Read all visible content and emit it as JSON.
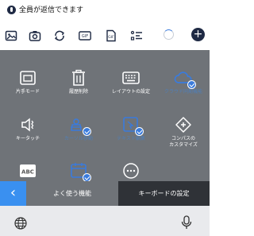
{
  "compose": {
    "reply_setting": "全員が返信できます"
  },
  "toolbar": {
    "icons": [
      "image-icon",
      "camera-icon",
      "sync-icon",
      "gif-icon",
      "gif-file-icon",
      "list-icon"
    ],
    "gif_label": "GIF"
  },
  "panel": {
    "items": [
      {
        "name": "one-hand-mode",
        "label": "片手モード",
        "icon": "one-hand-icon",
        "active": false
      },
      {
        "name": "clear-history",
        "label": "履歴削除",
        "icon": "trash-icon",
        "active": false
      },
      {
        "name": "layout-settings",
        "label": "レイアウトの設定",
        "icon": "keyboard-layout-icon",
        "active": false
      },
      {
        "name": "cloud-sync",
        "label": "クラウド同期機能",
        "icon": "cloud-icon",
        "active": true
      },
      {
        "name": "key-touch",
        "label": "キータッチ",
        "icon": "vibration-icon",
        "active": false
      },
      {
        "name": "voice-input",
        "label": "カーソル移動",
        "icon": "cursor-move-icon",
        "active": true
      },
      {
        "name": "text-edit",
        "label": "テキスト編集",
        "icon": "text-edit-icon",
        "active": true
      },
      {
        "name": "compass-customize",
        "label": "コンパスの\nカスタマイズ",
        "icon": "compass-icon",
        "active": false
      },
      {
        "name": "abc-mode",
        "label": "",
        "icon": "abc-icon",
        "active": false
      },
      {
        "name": "suggest",
        "label": "",
        "icon": "calendar-icon",
        "active": true
      },
      {
        "name": "more",
        "label": "",
        "icon": "more-icon",
        "active": false
      }
    ]
  },
  "tabbar": {
    "back": "‹",
    "common_label": "よく使う機能",
    "settings_label": "キーボードの設定"
  },
  "bottom": {
    "plus": "+"
  }
}
